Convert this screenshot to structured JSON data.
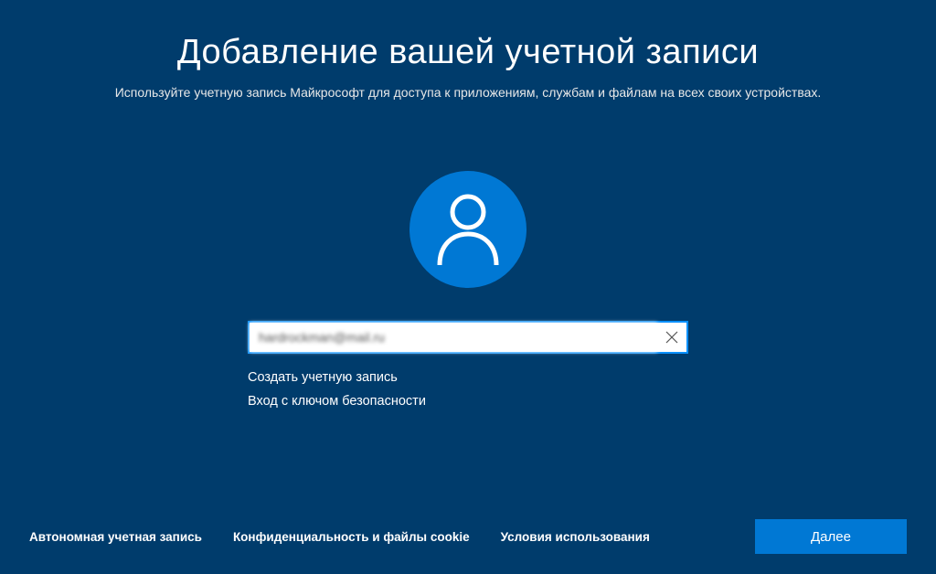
{
  "header": {
    "title": "Добавление вашей учетной записи",
    "subtitle": "Используйте учетную запись Майкрософт для доступа к приложениям, службам и файлам на всех своих устройствах."
  },
  "form": {
    "email_value": "hardrockman@mail.ru",
    "links": {
      "create_account": "Создать учетную запись",
      "security_key": "Вход с ключом безопасности"
    }
  },
  "footer": {
    "offline_account": "Автономная учетная запись",
    "privacy_cookies": "Конфиденциальность и файлы cookie",
    "terms_of_use": "Условия использования",
    "next_button": "Далее"
  },
  "colors": {
    "background": "#003c6c",
    "accent": "#0078d4",
    "input_border": "#0a90ff"
  }
}
